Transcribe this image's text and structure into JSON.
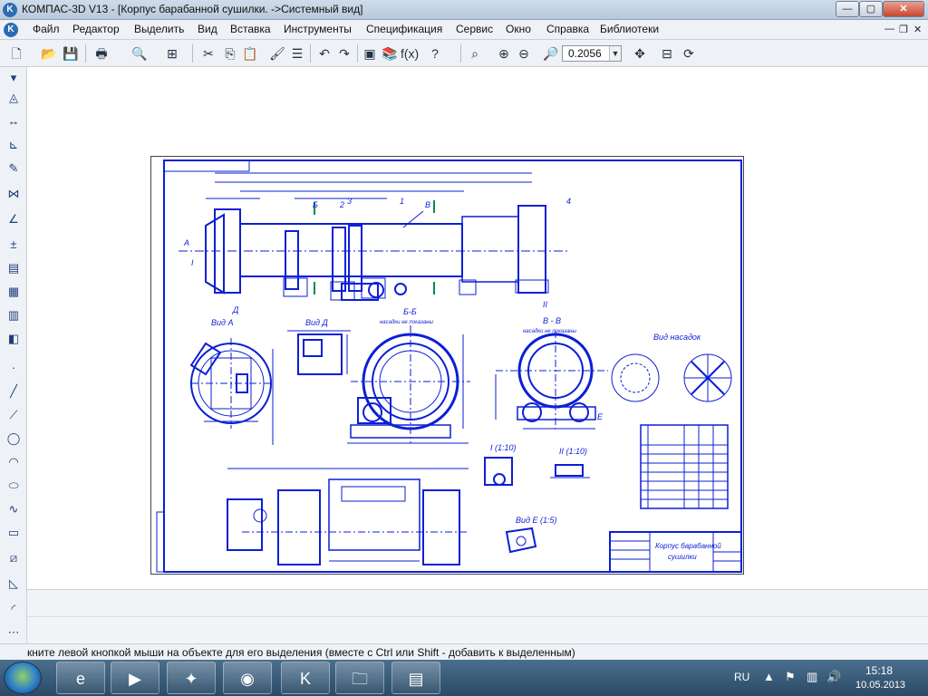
{
  "window": {
    "app_icon": "kompas-logo-icon",
    "title": "КОМПАС-3D V13 - [Корпус барабанной сушилки. ->Системный вид]",
    "controls": {
      "minimize": "—",
      "maximize": "▢",
      "close": "✕"
    }
  },
  "menu": {
    "items": [
      "Файл",
      "Редактор",
      "Выделить",
      "Вид",
      "Вставка",
      "Инструменты",
      "Спецификация",
      "Сервис",
      "Окно",
      "Справка",
      "Библиотеки"
    ],
    "mdi_controls": {
      "minimize": "—",
      "restore": "❐",
      "close": "✕"
    }
  },
  "toolbar": {
    "zoom_value": "0.2056",
    "icons": [
      "new-document-icon",
      "open-icon",
      "save-icon",
      "print-icon",
      "preview-icon",
      "layout-icon",
      "cut-icon",
      "copy-icon",
      "paste-icon",
      "format-painter-icon",
      "properties-icon",
      "undo-icon",
      "redo-icon",
      "manager-icon",
      "library-icon",
      "variables-icon",
      "help-pointer-icon",
      "zoom-window-icon",
      "zoom-in-icon",
      "zoom-out-icon",
      "zoom-scale-icon",
      "pan-icon",
      "refresh-icon"
    ]
  },
  "left_panel": {
    "icons": [
      "geometry-icon",
      "dimensions-icon",
      "designations-icon",
      "editing-icon",
      "parametrization-icon",
      "measure-icon",
      "selection-icon",
      "associative-view-icon",
      "spec-icon",
      "reports-icon",
      "insert-icon",
      "point-icon",
      "line-icon",
      "polyline-icon",
      "circle-icon",
      "arc-icon",
      "ellipse-icon",
      "spline-icon",
      "rectangle-icon",
      "hatch-icon",
      "chamfer-icon",
      "fillet-icon"
    ]
  },
  "drawing": {
    "views": {
      "view_a": "Вид А",
      "view_d": "Вид Д",
      "section_bb": "Б-Б",
      "section_vv": "В - В",
      "view_nasadok": "Вид насадок",
      "detail_1": "I (1:10)",
      "detail_2": "II (1:10)",
      "view_e": "Вид Е (1:5)"
    },
    "labels": {
      "rotated_sub": "насадки не показаны",
      "rotated_sub2": "насадки не показаны",
      "marker_a": "А",
      "marker_b": "Б",
      "marker_v": "В",
      "marker_d": "Д",
      "marker_e": "Е",
      "marker_i": "I",
      "marker_ii": "II",
      "part1": "1",
      "part2": "2",
      "part3": "3",
      "part4": "4"
    },
    "title_block": {
      "name_line1": "Корпус барабанной",
      "name_line2": "сушилки"
    }
  },
  "status": {
    "hint": "кните левой кнопкой мыши на объекте для его выделения (вместе с Ctrl или Shift - добавить к выделенным)"
  },
  "taskbar": {
    "apps": [
      "internet-explorer-icon",
      "media-player-icon",
      "tools-icon",
      "chrome-icon",
      "kompas-icon",
      "explorer-folder-icon",
      "winrar-icon"
    ],
    "language": "RU",
    "time": "15:18",
    "date": "10.05.2013"
  },
  "colors": {
    "drawing_line": "#0b1fd6",
    "titlebar": "#cfdcea",
    "taskbar": "#2b4a66"
  }
}
